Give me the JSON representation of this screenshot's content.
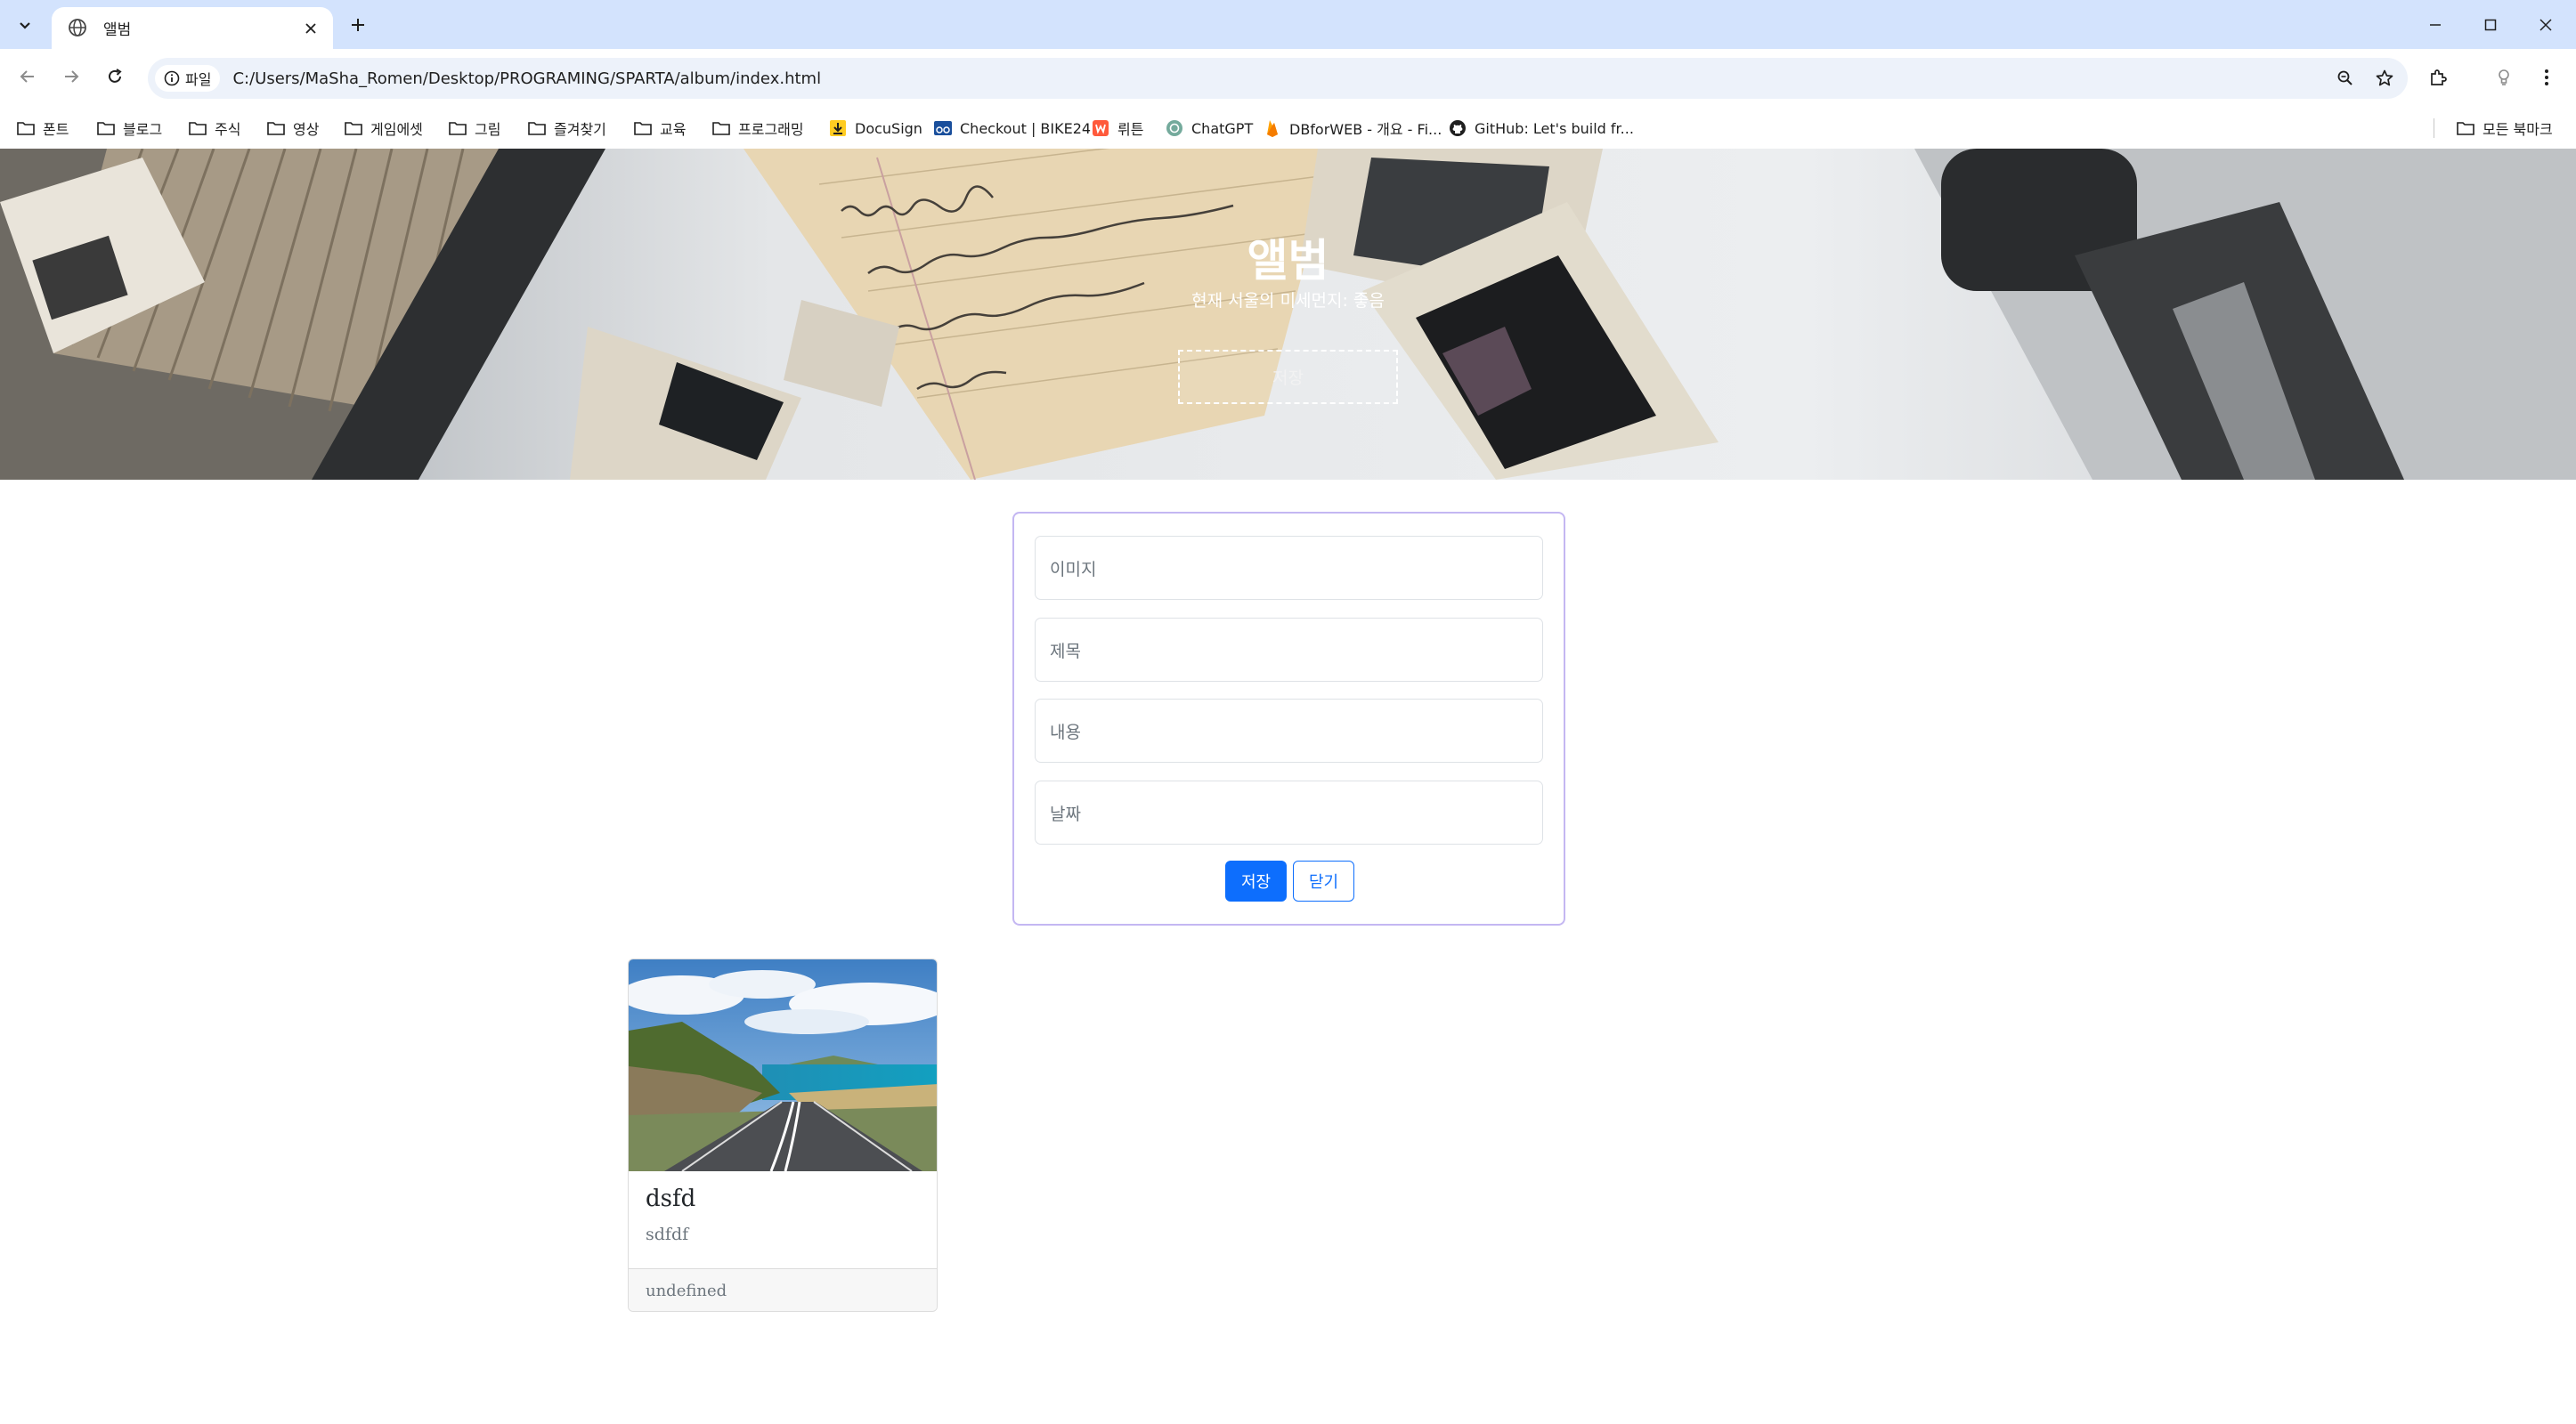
{
  "browser": {
    "tab": {
      "title": "앨범"
    },
    "site_chip": "파일",
    "url": "C:/Users/MaSha_Romen/Desktop/PROGRAMING/SPARTA/album/index.html",
    "bookmarks": [
      {
        "label": "폰트",
        "icon": "folder-icon"
      },
      {
        "label": "블로그",
        "icon": "folder-icon"
      },
      {
        "label": "주식",
        "icon": "folder-icon"
      },
      {
        "label": "영상",
        "icon": "folder-icon"
      },
      {
        "label": "게임에셋",
        "icon": "folder-icon"
      },
      {
        "label": "그림",
        "icon": "folder-icon"
      },
      {
        "label": "즐겨찾기",
        "icon": "folder-icon"
      },
      {
        "label": "교육",
        "icon": "folder-icon"
      },
      {
        "label": "프로그래밍",
        "icon": "folder-icon"
      },
      {
        "label": "DocuSign",
        "icon": "docusign-icon"
      },
      {
        "label": "Checkout | BIKE24",
        "icon": "bike24-icon"
      },
      {
        "label": "뤼튼",
        "icon": "wrtn-icon"
      },
      {
        "label": "ChatGPT",
        "icon": "chatgpt-icon"
      },
      {
        "label": "DBforWEB - 개요 - Fi...",
        "icon": "firebase-icon"
      },
      {
        "label": "GitHub: Let's build fr...",
        "icon": "github-icon"
      }
    ],
    "all_bookmarks": "모든 북마크"
  },
  "hero": {
    "title": "앨범",
    "subtitle": "현재 서울의 미세먼지: 좋음",
    "button": "저장"
  },
  "form": {
    "image_placeholder": "이미지",
    "title_placeholder": "제목",
    "content_placeholder": "내용",
    "date_placeholder": "날짜",
    "save_label": "저장",
    "close_label": "닫기"
  },
  "cards": [
    {
      "title": "dsfd",
      "text": "sdfdf",
      "footer": "undefined"
    }
  ],
  "colors": {
    "tabstrip": "#d3e3fd",
    "omnibox": "#edf2fa",
    "primary": "#0d6efd",
    "form_border": "#c4b7f2"
  }
}
